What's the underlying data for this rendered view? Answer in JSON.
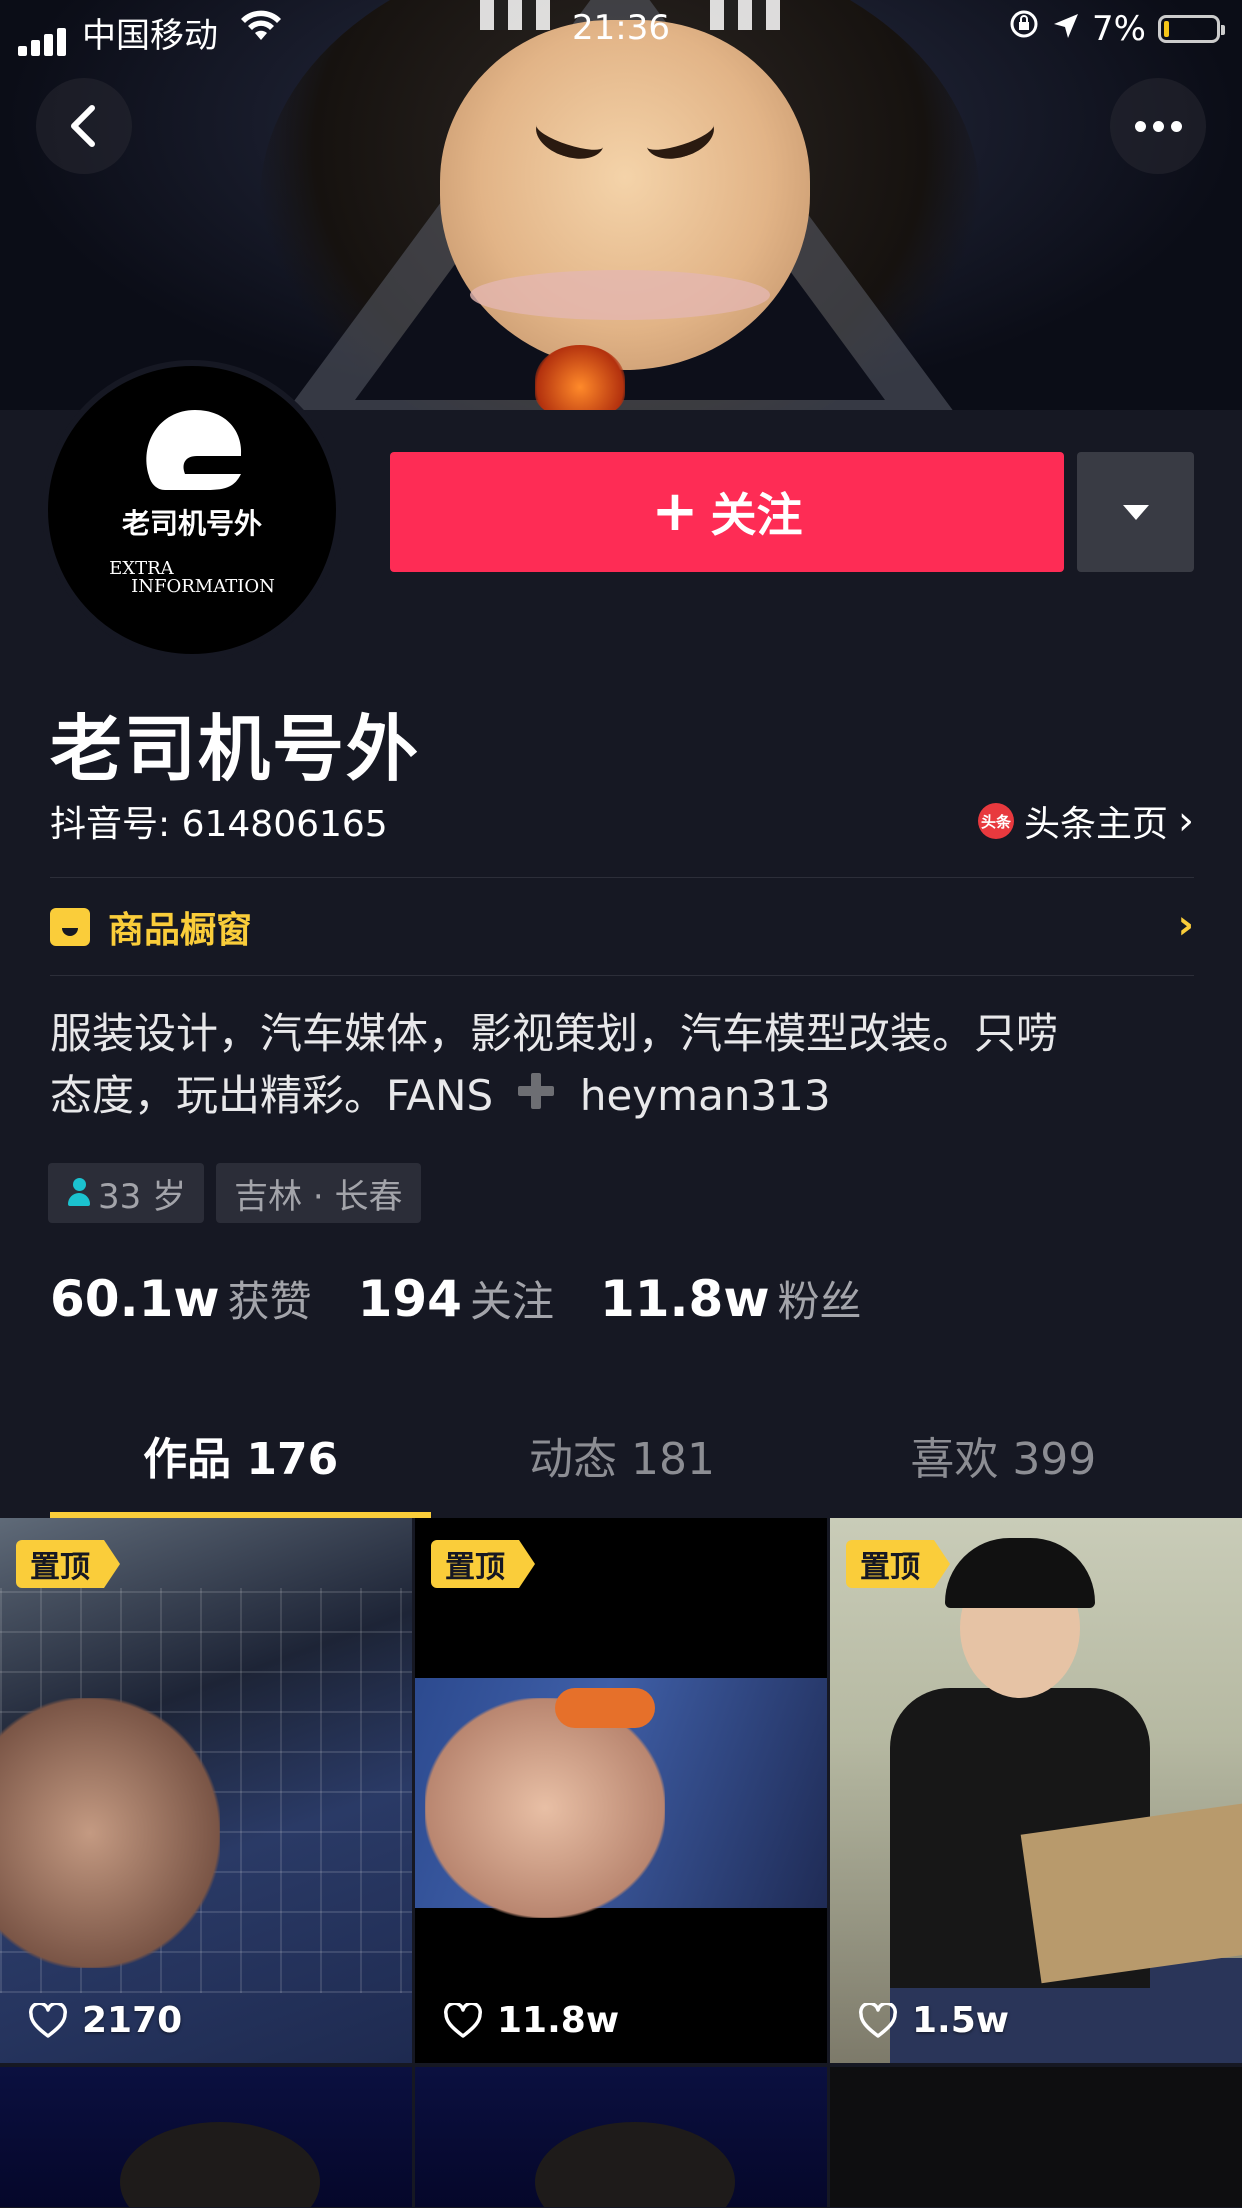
{
  "status_bar": {
    "carrier": "中国移动",
    "time": "21:36",
    "battery": "7%",
    "battery_level": 0.07
  },
  "profile": {
    "avatar_title": "老司机号外",
    "avatar_subtitle_line1": "EXTRA",
    "avatar_subtitle_line2": "INFORMATION",
    "follow_label": "关注",
    "nickname": "老司机号外",
    "douyin_id": "抖音号: 614806165",
    "toutiao_icon_text": "头条",
    "toutiao_link": "头条主页",
    "shop_label": "商品橱窗",
    "bio_line1": "服装设计，汽车媒体，影视策划，汽车模型改装。只唠",
    "bio_line2_prefix": "态度，玩出精彩。FANS",
    "bio_line2_suffix": "heyman313",
    "tags": [
      "33 岁",
      "吉林 · 长春"
    ],
    "stats": [
      {
        "value": "60.1w",
        "label": "获赞"
      },
      {
        "value": "194",
        "label": "关注"
      },
      {
        "value": "11.8w",
        "label": "粉丝"
      }
    ]
  },
  "tabs": [
    {
      "label": "作品 176",
      "active": true
    },
    {
      "label": "动态 181",
      "active": false
    },
    {
      "label": "喜欢 399",
      "active": false
    }
  ],
  "videos": [
    {
      "pin": "置顶",
      "likes": "2170"
    },
    {
      "pin": "置顶",
      "likes": "11.8w"
    },
    {
      "pin": "置顶",
      "likes": "1.5w"
    }
  ],
  "colors": {
    "background": "#161823",
    "follow_button": "#fe2c55",
    "accent_yellow": "#facd3a"
  }
}
